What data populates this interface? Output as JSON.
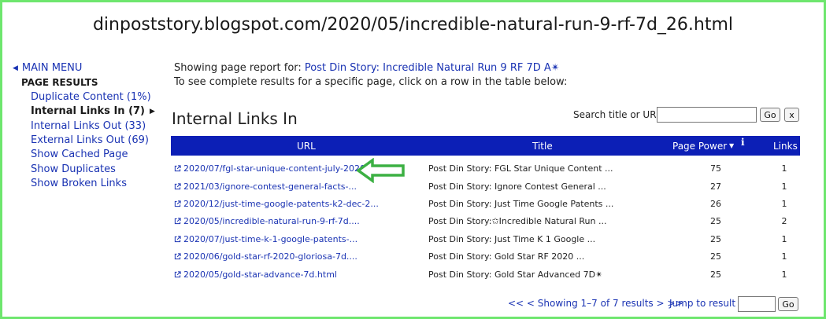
{
  "page_url": "dinpoststory.blogspot.com/2020/05/incredible-natural-run-9-rf-7d_26.html",
  "sidebar": {
    "main_menu": "MAIN MENU",
    "page_results": "PAGE RESULTS",
    "items": [
      {
        "label": "Duplicate Content (1%)"
      },
      {
        "label": "Internal Links In (7)"
      },
      {
        "label": "Internal Links Out (33)"
      },
      {
        "label": "External Links Out (69)"
      },
      {
        "label": "Show Cached Page"
      },
      {
        "label": "Show Duplicates"
      },
      {
        "label": "Show Broken Links"
      }
    ]
  },
  "info": {
    "prefix": "Showing page report for: ",
    "page_link": "Post Din Story: Incredible Natural Run 9 RF 7D A✴",
    "instructions": "To see complete results for a specific page, click on a row in the table below:"
  },
  "section_title": "Internal Links In",
  "search": {
    "label": "Search title or URL",
    "value": "",
    "go": "Go",
    "clear": "x"
  },
  "table": {
    "headers": {
      "url": "URL",
      "title": "Title",
      "page_power": "Page Power",
      "sort_indicator": "▼",
      "info": "i",
      "links": "Links"
    },
    "rows": [
      {
        "url": "2020/07/fgl-star-unique-content-july-2020....",
        "title": "Post Din Story: FGL Star Unique Content ...",
        "power": "75",
        "links": "1"
      },
      {
        "url": "2021/03/ignore-contest-general-facts-...",
        "title": "Post Din Story: Ignore Contest General ...",
        "power": "27",
        "links": "1"
      },
      {
        "url": "2020/12/just-time-google-patents-k2-dec-2...",
        "title": "Post Din Story: Just Time Google Patents ...",
        "power": "26",
        "links": "1"
      },
      {
        "url": "2020/05/incredible-natural-run-9-rf-7d....",
        "title": "Post Din Story:✩Incredible Natural Run ...",
        "power": "25",
        "links": "2"
      },
      {
        "url": "2020/07/just-time-k-1-google-patents-...",
        "title": "Post Din Story: Just Time K 1 Google ...",
        "power": "25",
        "links": "1"
      },
      {
        "url": "2020/06/gold-star-rf-2020-gloriosa-7d....",
        "title": "Post Din Story: Gold Star RF 2020 ...",
        "power": "25",
        "links": "1"
      },
      {
        "url": "2020/05/gold-star-advance-7d.html",
        "title": "Post Din Story: Gold Star Advanced 7D✴",
        "power": "25",
        "links": "1"
      }
    ]
  },
  "pager": {
    "text": "<< <  Showing 1–7 of 7 results >  >>",
    "jump_label": "Jump to result",
    "jump_value": "",
    "go": "Go"
  },
  "colors": {
    "frame_border": "#6ee66e",
    "header_bg": "#0c1fb6",
    "link": "#1a33b3",
    "arrow": "#3cb043"
  },
  "icons": {
    "external_link": "external-link-icon",
    "annotation_arrow": "left-arrow-icon"
  }
}
